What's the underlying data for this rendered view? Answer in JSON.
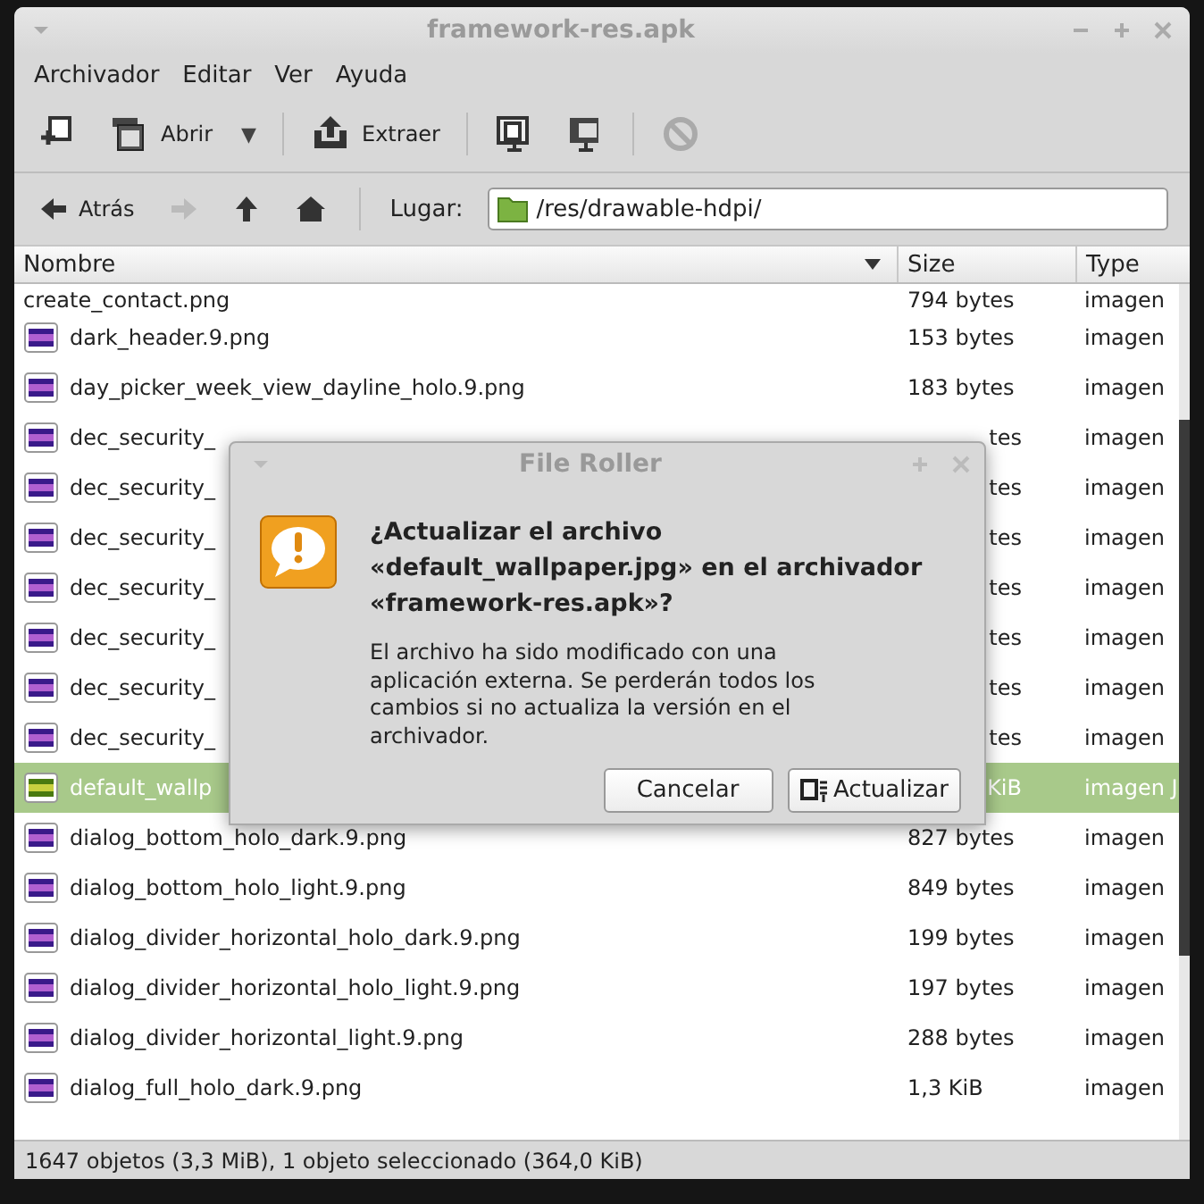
{
  "window": {
    "title": "framework-res.apk"
  },
  "menu": [
    "Archivador",
    "Editar",
    "Ver",
    "Ayuda"
  ],
  "toolbar": [
    {
      "kind": "new"
    },
    {
      "kind": "open",
      "label": "Abrir"
    },
    {
      "kind": "dropdown",
      "label": "▼"
    },
    {
      "kind": "sep"
    },
    {
      "kind": "extract",
      "label": "Extraer"
    },
    {
      "kind": "sep"
    },
    {
      "kind": "view"
    },
    {
      "kind": "view2"
    },
    {
      "kind": "sep"
    },
    {
      "kind": "stop",
      "disabled": true
    }
  ],
  "location": {
    "back": "Atrás",
    "forward_disabled": true,
    "label": "Lugar:",
    "value": "/res/drawable-hdpi/"
  },
  "table": {
    "columns": [
      "Nombre",
      "Size",
      "Type"
    ],
    "rows": [
      {
        "name": "create_contact.png",
        "size": "794 bytes",
        "type": "imagen",
        "kind": "png",
        "selected": false,
        "obscured": false
      },
      {
        "name": "dark_header.9.png",
        "size": "153 bytes",
        "type": "imagen",
        "kind": "png",
        "selected": false,
        "obscured": false
      },
      {
        "name": "day_picker_week_view_dayline_holo.9.png",
        "size": "183 bytes",
        "type": "imagen",
        "kind": "png",
        "selected": false,
        "obscured": false
      },
      {
        "name": "dec_security_",
        "size": "tes",
        "type": "imagen",
        "kind": "png",
        "selected": false,
        "obscured": true
      },
      {
        "name": "dec_security_",
        "size": "tes",
        "type": "imagen",
        "kind": "png",
        "selected": false,
        "obscured": true
      },
      {
        "name": "dec_security_",
        "size": "tes",
        "type": "imagen",
        "kind": "png",
        "selected": false,
        "obscured": true
      },
      {
        "name": "dec_security_",
        "size": "tes",
        "type": "imagen",
        "kind": "png",
        "selected": false,
        "obscured": true
      },
      {
        "name": "dec_security_",
        "size": "tes",
        "type": "imagen",
        "kind": "png",
        "selected": false,
        "obscured": true
      },
      {
        "name": "dec_security_",
        "size": "tes",
        "type": "imagen",
        "kind": "png",
        "selected": false,
        "obscured": true
      },
      {
        "name": "dec_security_",
        "size": "tes",
        "type": "imagen",
        "kind": "png",
        "selected": false,
        "obscured": true
      },
      {
        "name": "default_wallp",
        "size": "KiB",
        "type": "imagen J",
        "kind": "jpg",
        "selected": true,
        "obscured": true
      },
      {
        "name": "dialog_bottom_holo_dark.9.png",
        "size": "827 bytes",
        "type": "imagen",
        "kind": "png",
        "selected": false,
        "obscured": false
      },
      {
        "name": "dialog_bottom_holo_light.9.png",
        "size": "849 bytes",
        "type": "imagen",
        "kind": "png",
        "selected": false,
        "obscured": false
      },
      {
        "name": "dialog_divider_horizontal_holo_dark.9.png",
        "size": "199 bytes",
        "type": "imagen",
        "kind": "png",
        "selected": false,
        "obscured": false
      },
      {
        "name": "dialog_divider_horizontal_holo_light.9.png",
        "size": "197 bytes",
        "type": "imagen",
        "kind": "png",
        "selected": false,
        "obscured": false
      },
      {
        "name": "dialog_divider_horizontal_light.9.png",
        "size": "288 bytes",
        "type": "imagen",
        "kind": "png",
        "selected": false,
        "obscured": false
      },
      {
        "name": "dialog_full_holo_dark.9.png",
        "size": "1,3 KiB",
        "type": "imagen",
        "kind": "png",
        "selected": false,
        "obscured": false
      }
    ]
  },
  "status_bar": "1647 objetos (3,3 MiB), 1 objeto seleccionado (364,0 KiB)",
  "dialog": {
    "title": "File Roller",
    "heading": "¿Actualizar el archivo «default_wallpaper.jpg» en el archivador «framework-res.apk»?",
    "message": "El archivo ha sido modificado con una aplicación externa. Se perderán todos los cambios si no actualiza la versión en el archivador.",
    "buttons": [
      {
        "label": "Cancelar",
        "kind": "cancel"
      },
      {
        "label": "Actualizar",
        "kind": "update"
      }
    ]
  }
}
